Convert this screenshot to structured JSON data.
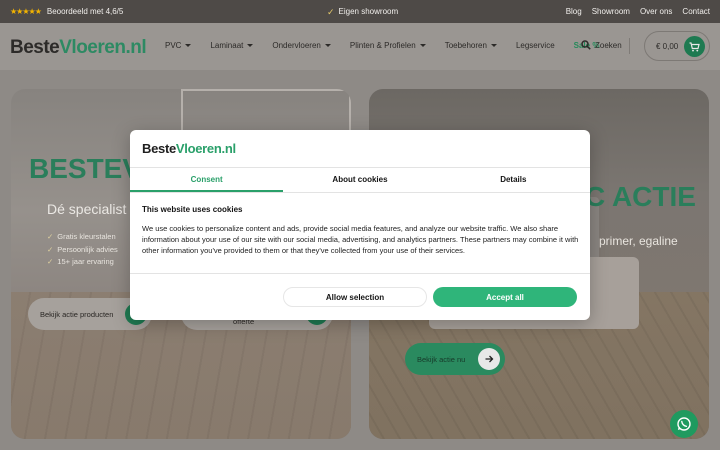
{
  "topbar": {
    "stars": "★★★★★",
    "rating_text": "Beoordeeld met 4,6/5",
    "showroom_text": "Eigen showroom",
    "links": [
      "Blog",
      "Showroom",
      "Over ons",
      "Contact"
    ]
  },
  "header": {
    "logo_part1": "Beste",
    "logo_part2": "Vloeren.nl",
    "nav": [
      "PVC",
      "Laminaat",
      "Ondervloeren",
      "Plinten & Profielen",
      "Toebehoren"
    ],
    "nav_plain": "Legservice",
    "nav_sale": "Sale %",
    "search_label": "Zoeken",
    "cart_total": "€ 0,00"
  },
  "hero_left": {
    "title": "BESTEV",
    "subtitle": "Dé specialist i",
    "usps": [
      "Gratis kleurstalen",
      "Persoonlijk advies",
      "15+ jaar ervaring"
    ],
    "btn_primary": "Bekijk actie producten",
    "btn_secondary": "offerte"
  },
  "hero_right": {
    "title": "C ACTIE",
    "subtitle": "primer, egaline",
    "btn": "Bekijk actie nu"
  },
  "cookie_dialog": {
    "logo_part1": "Beste",
    "logo_part2": "Vloeren.nl",
    "tabs": [
      "Consent",
      "About cookies",
      "Details"
    ],
    "heading": "This website uses cookies",
    "text": "We use cookies to personalize content and ads, provide social media features, and analyze our website traffic. We also share information about your use of our site with our social media, advertising, and analytics partners. These partners may combine it with other information you've provided to them or that they've collected from your use of their services.",
    "btn_allow": "Allow selection",
    "btn_accept": "Accept all"
  },
  "colors": {
    "accent": "#2aa06a",
    "topbar": "#4e4a47"
  }
}
